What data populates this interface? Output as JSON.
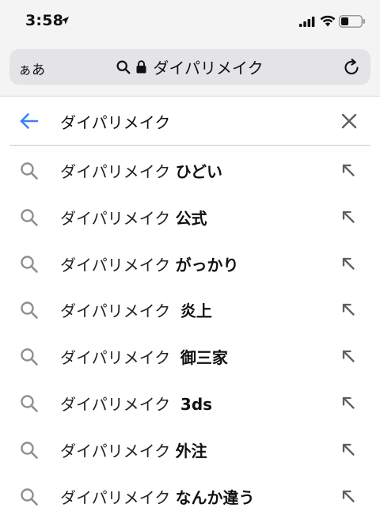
{
  "status_bar": {
    "time": "3:58"
  },
  "browser": {
    "aa_label": "ぁあ",
    "url_text": "ダイパリメイク"
  },
  "search": {
    "query": "ダイパリメイク"
  },
  "suggestions": [
    {
      "prefix": "ダイパリメイク ",
      "bold": "ひどい"
    },
    {
      "prefix": "ダイパリメイク ",
      "bold": "公式"
    },
    {
      "prefix": "ダイパリメイク ",
      "bold": "がっかり"
    },
    {
      "prefix": "ダイパリメイク  ",
      "bold": "炎上"
    },
    {
      "prefix": "ダイパリメイク  ",
      "bold": "御三家"
    },
    {
      "prefix": "ダイパリメイク  ",
      "bold": "3ds"
    },
    {
      "prefix": "ダイパリメイク ",
      "bold": "外注"
    },
    {
      "prefix": "ダイパリメイク ",
      "bold": "なんか違う"
    }
  ],
  "colors": {
    "accent": "#3a82f7",
    "icon_gray": "#8e8e93"
  },
  "icons": {
    "location": "location-arrow-icon",
    "signal": "cellular-signal-icon",
    "wifi": "wifi-icon",
    "battery": "battery-icon",
    "search": "search-icon",
    "lock": "lock-icon",
    "reload": "reload-icon",
    "back": "back-arrow-icon",
    "clear": "close-icon",
    "fill": "fill-query-arrow-icon"
  }
}
